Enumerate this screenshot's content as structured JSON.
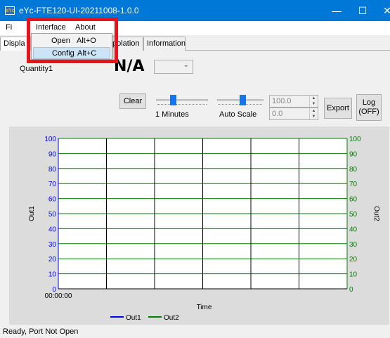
{
  "window": {
    "title": "eYc-FTE120-UI-20211008-1.0.0",
    "icon_text": "eYc",
    "min_glyph": "—",
    "max_glyph": "☐",
    "close_glyph": "✕"
  },
  "menubar": {
    "items": [
      "Fi",
      "Interface",
      "About"
    ]
  },
  "dropdown": {
    "items": [
      {
        "label": "Open",
        "shortcut": "Alt+O",
        "highlighted": false
      },
      {
        "label": "Config",
        "shortcut": "Alt+C",
        "highlighted": true
      }
    ]
  },
  "tabs": {
    "items": [
      "Displa",
      "polation",
      "Information"
    ]
  },
  "quantity": {
    "label": "Quantity1",
    "value": "N/A"
  },
  "controls": {
    "clear_label": "Clear",
    "time_label": "1 Minutes",
    "scale_label": "Auto Scale",
    "max_value": "100.0",
    "min_value": "0.0",
    "export_label": "Export",
    "log_label_line1": "Log",
    "log_label_line2": "(OFF)"
  },
  "chart_data": {
    "type": "line",
    "ylabel": "Out1",
    "ylabel_right": "Out2",
    "xlabel": "Time",
    "x_start_label": "00:00:00",
    "ylim": [
      0,
      100
    ],
    "yticks": [
      0,
      10,
      20,
      30,
      40,
      50,
      60,
      70,
      80,
      90,
      100
    ],
    "vertical_gridlines": 6,
    "series": [
      {
        "name": "Out1",
        "color": "#0000ff",
        "values": []
      },
      {
        "name": "Out2",
        "color": "#008000",
        "values": []
      }
    ],
    "colors": {
      "left_axis": "#0000ff",
      "right_axis": "#008000",
      "horizontal_grid": "#008000",
      "vertical_grid": "#000000"
    }
  },
  "statusbar": {
    "text": "Ready,  Port Not Open"
  },
  "colors": {
    "titlebar": "#0078d7",
    "highlight_box": "#e8141b"
  }
}
